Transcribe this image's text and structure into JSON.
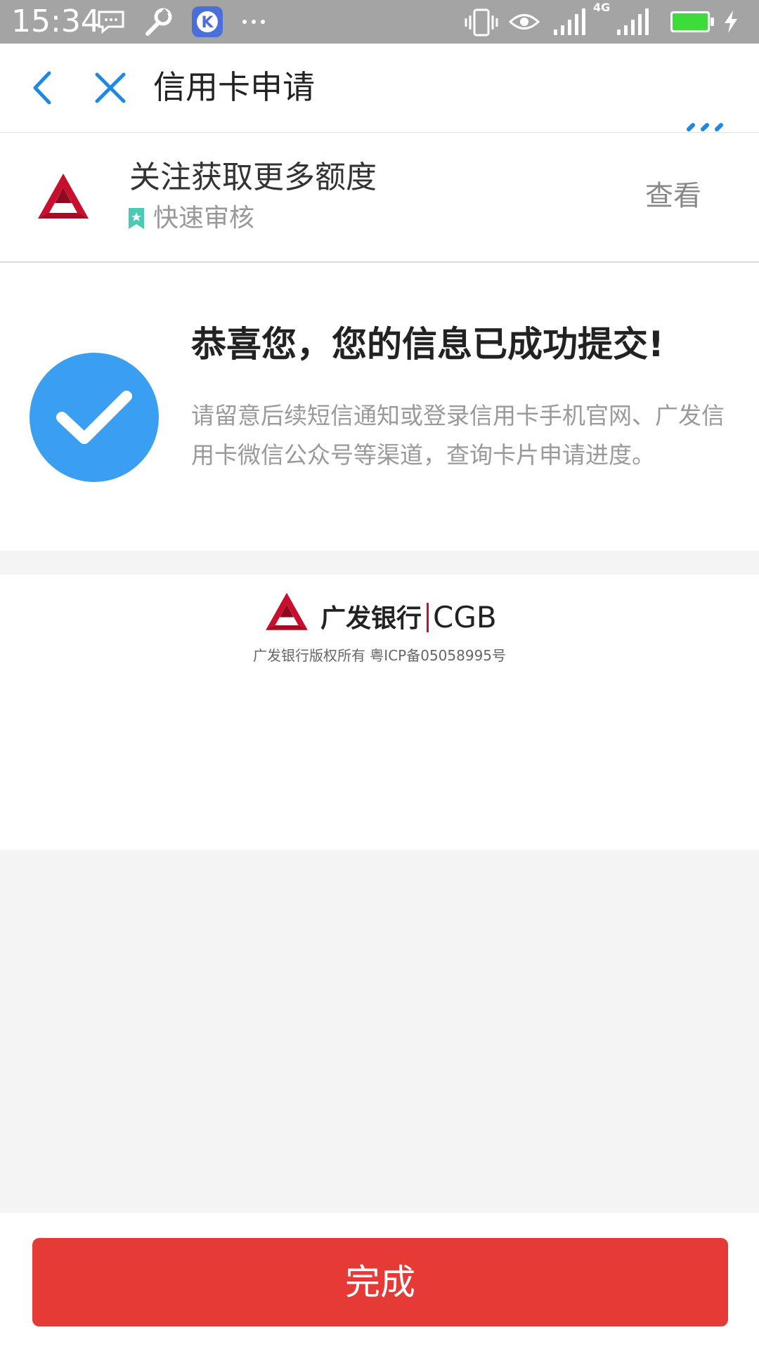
{
  "status_bar": {
    "time": "15:34",
    "network": "4G",
    "icons": [
      "message-icon",
      "wrench-icon",
      "app-k-icon",
      "more-dots-icon",
      "vibrate-icon",
      "eye-icon",
      "signal-icon",
      "signal-icon",
      "battery-icon",
      "charging-icon"
    ]
  },
  "nav": {
    "title": "信用卡申请",
    "accent_color": "#1e88e5"
  },
  "follow_banner": {
    "title": "关注获取更多额度",
    "subtitle": "快速审核",
    "view_label": "查看"
  },
  "success": {
    "title": "恭喜您，您的信息已成功提交!",
    "description": "请留意后续短信通知或登录信用卡手机官网、广发信用卡微信公众号等渠道，查询卡片申请进度。",
    "check_color": "#3a9ff0"
  },
  "footer": {
    "bank_name_cn": "广发银行",
    "bank_name_en": "CGB",
    "copyright": "广发银行版权所有 粤ICP备05058995号",
    "brand_color": "#c8102e"
  },
  "bottom": {
    "done_label": "完成",
    "button_color": "#e53a35"
  }
}
